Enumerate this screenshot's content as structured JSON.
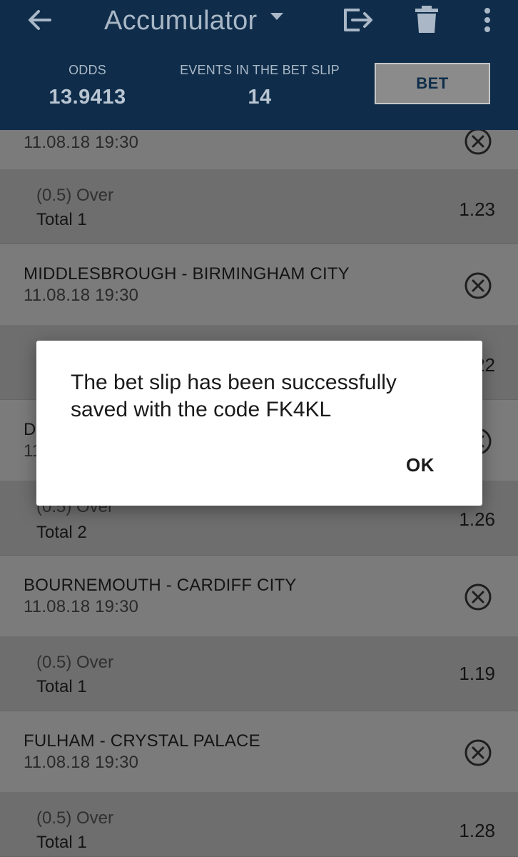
{
  "toolbar": {
    "title": "Accumulator",
    "icons": {
      "back": "arrow-left-icon",
      "dropdown": "caret-down-icon",
      "share": "share-exit-icon",
      "delete": "trash-icon",
      "more": "more-vert-icon"
    }
  },
  "summary": {
    "odds_label": "ODDS",
    "odds_value": "13.9413",
    "events_label": "EVENTS IN THE BET SLIP",
    "events_value": "14",
    "bet_label": "BET"
  },
  "rows": [
    {
      "type": "event",
      "name": "",
      "time": "11.08.18 19:30"
    },
    {
      "type": "bet",
      "line": "(0.5) Over",
      "market": "Total 1",
      "odds": "1.23"
    },
    {
      "type": "event",
      "name": "MIDDLESBROUGH - BIRMINGHAM CITY",
      "time": "11.08.18 19:30"
    },
    {
      "type": "bet",
      "line": "",
      "market": "",
      "odds": "1.22"
    },
    {
      "type": "event",
      "name": "D",
      "time": "11"
    },
    {
      "type": "bet",
      "line": "(0.5) Over",
      "market": "Total 2",
      "odds": "1.26"
    },
    {
      "type": "event",
      "name": "BOURNEMOUTH - CARDIFF CITY",
      "time": "11.08.18 19:30"
    },
    {
      "type": "bet",
      "line": "(0.5) Over",
      "market": "Total 1",
      "odds": "1.19"
    },
    {
      "type": "event",
      "name": "FULHAM - CRYSTAL PALACE",
      "time": "11.08.18 19:30"
    },
    {
      "type": "bet",
      "line": "(0.5) Over",
      "market": "Total 1",
      "odds": "1.28"
    }
  ],
  "dialog": {
    "message": "The bet slip has been successfully saved with the code FK4KL",
    "ok_label": "OK"
  },
  "colors": {
    "header_bg": "#0f2d4a",
    "header_text": "#a9b7c6",
    "overlay_event_row": "#7b7b7b",
    "overlay_bet_row": "#6e6e6e",
    "dialog_bg": "#ffffff"
  }
}
